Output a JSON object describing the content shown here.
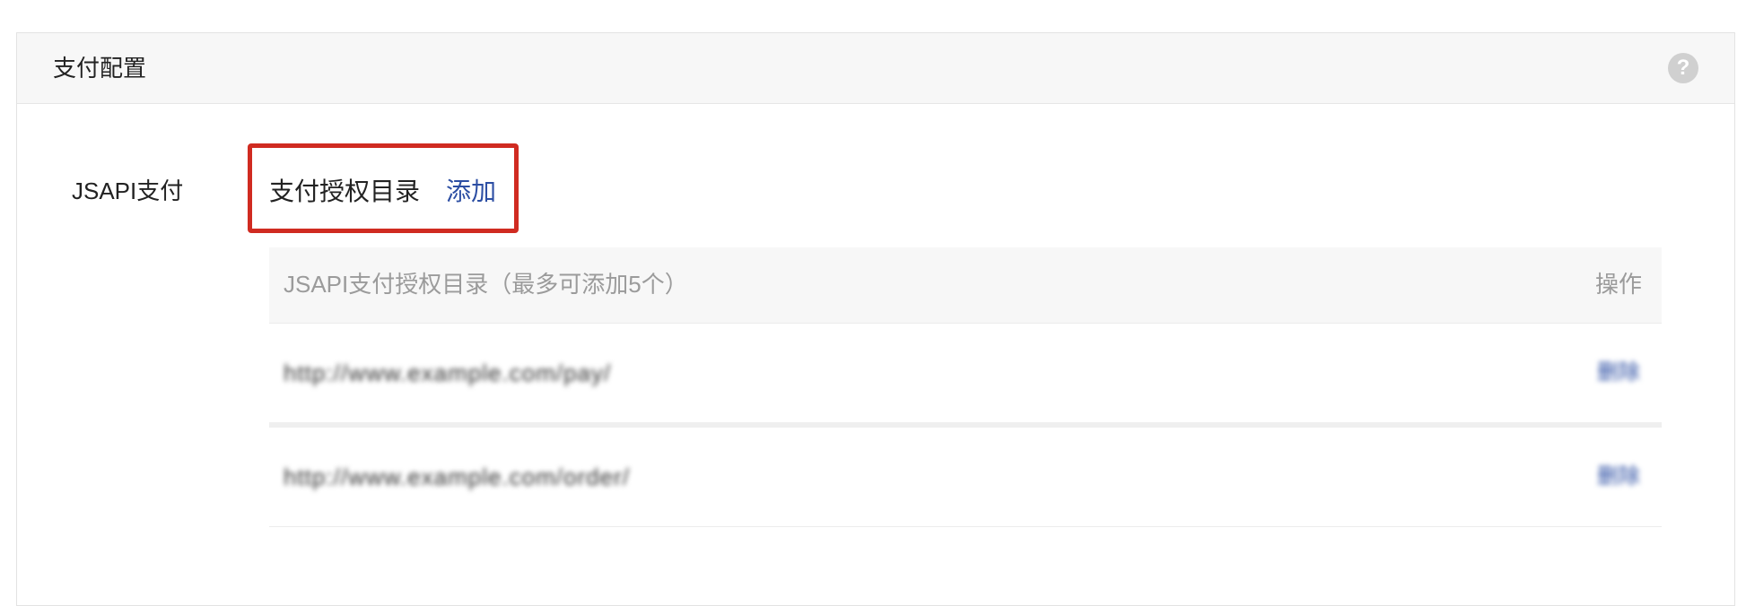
{
  "panel": {
    "title": "支付配置",
    "help_icon": "question-circle-icon",
    "help_glyph": "?"
  },
  "jsapi": {
    "label": "JSAPI支付",
    "auth_dir_label": "支付授权目录",
    "add_link": "添加"
  },
  "table": {
    "headers": {
      "directory": "JSAPI支付授权目录（最多可添加5个）",
      "operation": "操作"
    },
    "rows": [
      {
        "url": "http://www.example.com/pay/",
        "action": "删除"
      },
      {
        "url": "http://www.example.com/order/",
        "action": "删除"
      }
    ]
  },
  "colors": {
    "highlight_border": "#d02b21",
    "link": "#2c4ea3",
    "header_bg": "#f7f7f7",
    "muted_text": "#9b9b9b"
  }
}
